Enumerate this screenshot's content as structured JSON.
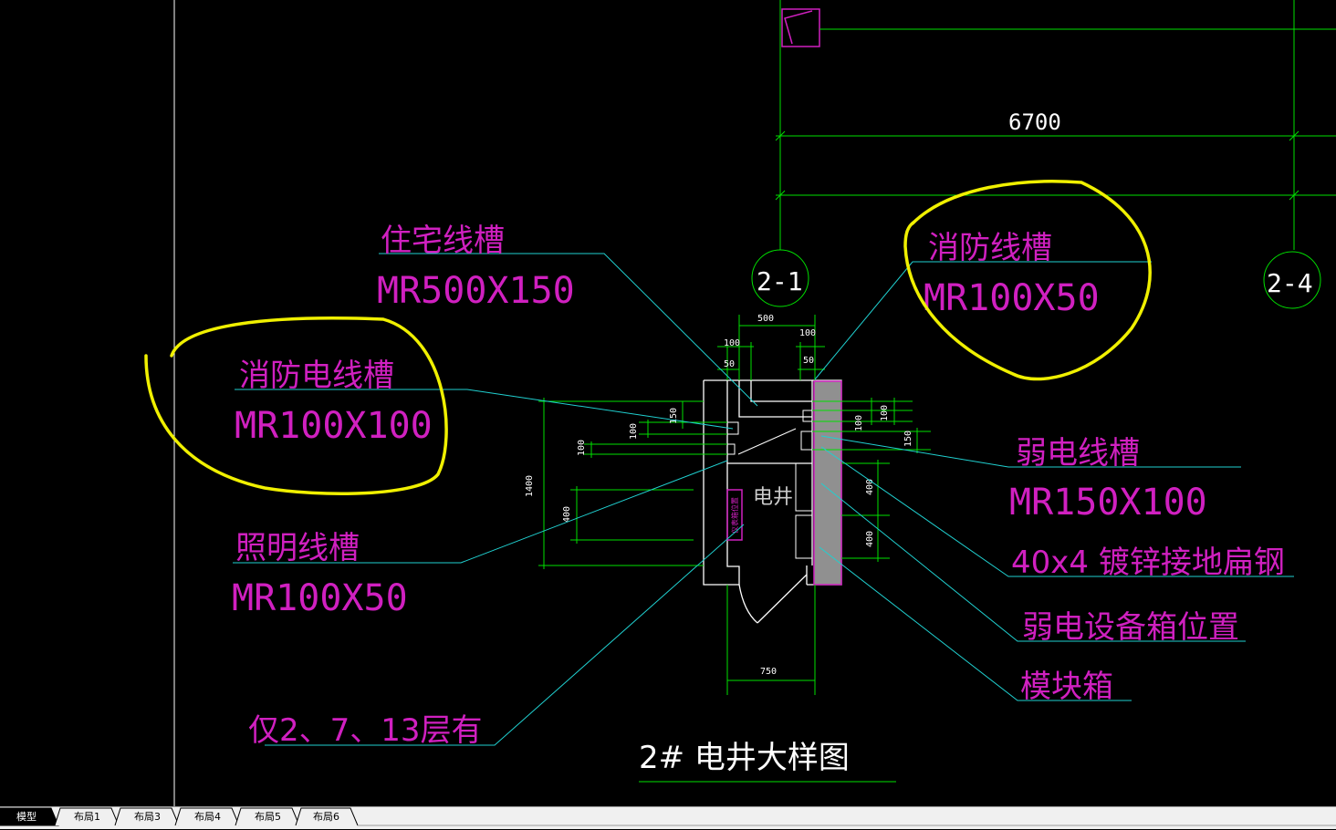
{
  "colors": {
    "background": "#000000",
    "green": "#00e000",
    "magenta": "#d020c0",
    "cyan": "#20d0d0",
    "white": "#ffffff",
    "yellow": "#f0f000",
    "fill_gray": "#909090"
  },
  "drawing": {
    "dim_6700": "6700",
    "axis_left": "2-1",
    "axis_right": "2-4",
    "dim_500": "500",
    "dim_100_left": "100",
    "dim_50_left": "50",
    "dim_100_right": "100",
    "dim_50_right": "50",
    "dim_150_left": "150",
    "dim_100_a": "100",
    "dim_100_b": "100",
    "dim_1400": "1400",
    "dim_400_left": "400",
    "dim_100_r1": "100",
    "dim_100_r2": "100",
    "dim_150_r": "150",
    "dim_400_r1": "400",
    "dim_400_r2": "400",
    "dim_750": "750",
    "room_label": "电井",
    "box_label": "仪表箱位置",
    "title": "2# 电井大样图"
  },
  "callouts": [
    {
      "name": "住宅线槽",
      "spec": "MR500X150"
    },
    {
      "name": "消防电线槽",
      "spec": "MR100X100"
    },
    {
      "name": "照明线槽",
      "spec": "MR100X50"
    },
    {
      "name": "仅2、7、13层有",
      "spec": ""
    },
    {
      "name": "消防线槽",
      "spec": "MR100X50"
    },
    {
      "name": "弱电线槽",
      "spec": "MR150X100"
    },
    {
      "name": "40x4 镀锌接地扁钢",
      "spec": ""
    },
    {
      "name": "弱电设备箱位置",
      "spec": ""
    },
    {
      "name": "模块箱",
      "spec": ""
    }
  ],
  "tabs": [
    {
      "label": "模型",
      "active": true
    },
    {
      "label": "布局1",
      "active": false
    },
    {
      "label": "布局3",
      "active": false
    },
    {
      "label": "布局4",
      "active": false
    },
    {
      "label": "布局5",
      "active": false
    },
    {
      "label": "布局6",
      "active": false
    }
  ]
}
